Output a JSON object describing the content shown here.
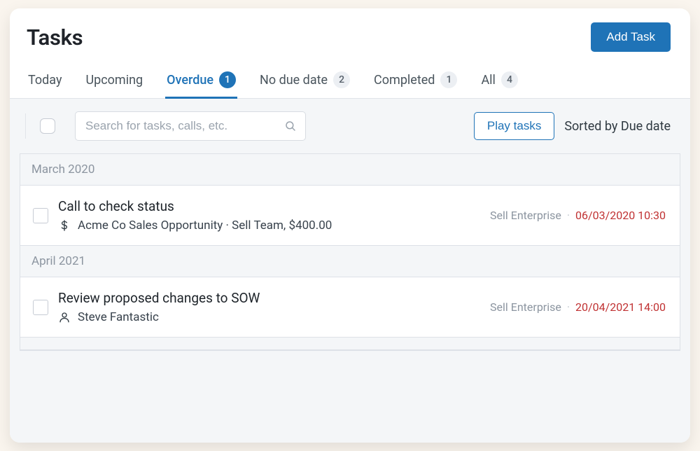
{
  "header": {
    "title": "Tasks",
    "add_button": "Add Task"
  },
  "tabs": [
    {
      "label": "Today",
      "count": null,
      "active": false
    },
    {
      "label": "Upcoming",
      "count": null,
      "active": false
    },
    {
      "label": "Overdue",
      "count": 1,
      "active": true
    },
    {
      "label": "No due date",
      "count": 2,
      "active": false
    },
    {
      "label": "Completed",
      "count": 1,
      "active": false
    },
    {
      "label": "All",
      "count": 4,
      "active": false
    }
  ],
  "toolbar": {
    "search_placeholder": "Search for tasks, calls, etc.",
    "play_label": "Play tasks",
    "sort_label": "Sorted by Due date"
  },
  "groups": [
    {
      "heading": "March 2020",
      "task": {
        "title": "Call to check status",
        "icon": "dollar",
        "sub": "Acme Co Sales Opportunity · Sell Team, $400.00",
        "tag": "Sell Enterprise",
        "date": "06/03/2020 10:30"
      }
    },
    {
      "heading": "April 2021",
      "task": {
        "title": "Review proposed changes to SOW",
        "icon": "person",
        "sub": "Steve Fantastic",
        "tag": "Sell Enterprise",
        "date": "20/04/2021 14:00"
      }
    }
  ]
}
